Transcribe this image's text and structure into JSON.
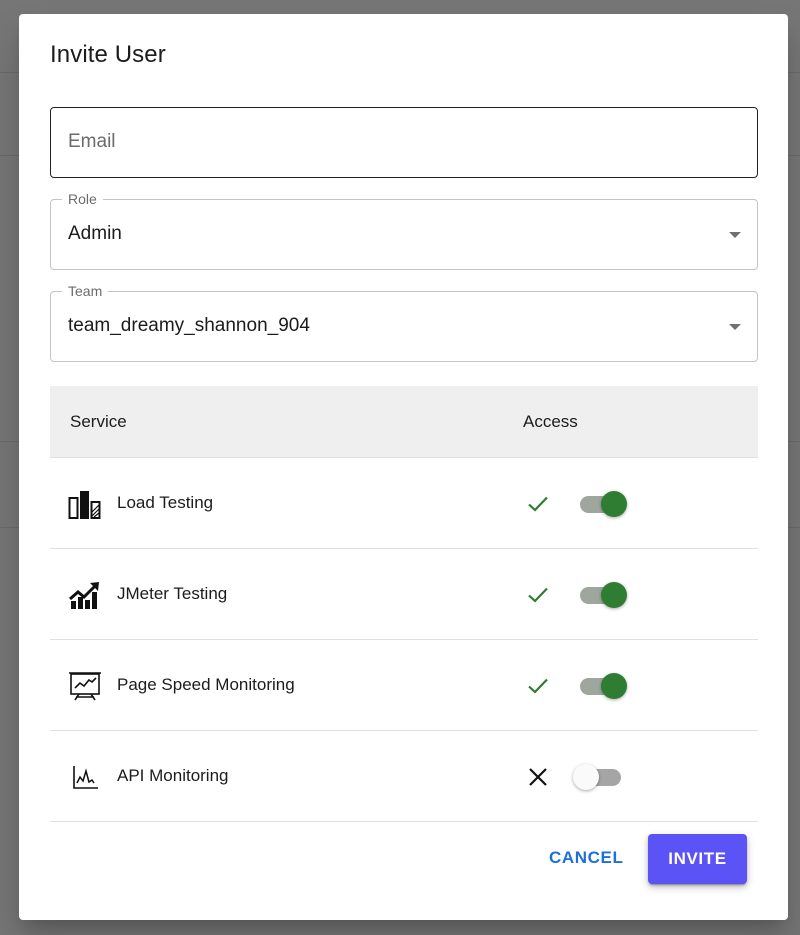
{
  "dialog": {
    "title": "Invite User",
    "email": {
      "placeholder": "Email",
      "value": ""
    },
    "role": {
      "label": "Role",
      "value": "Admin"
    },
    "team": {
      "label": "Team",
      "value": "team_dreamy_shannon_904"
    },
    "table": {
      "headers": {
        "service": "Service",
        "access": "Access"
      },
      "rows": [
        {
          "icon": "bar-chart-icon",
          "label": "Load Testing",
          "access": true,
          "status_icon": "check-icon"
        },
        {
          "icon": "trending-up-icon",
          "label": "JMeter Testing",
          "access": true,
          "status_icon": "check-icon"
        },
        {
          "icon": "presentation-chart-icon",
          "label": "Page Speed Monitoring",
          "access": true,
          "status_icon": "check-icon"
        },
        {
          "icon": "pulse-chart-icon",
          "label": "API Monitoring",
          "access": false,
          "status_icon": "close-icon"
        }
      ]
    },
    "actions": {
      "cancel": "CANCEL",
      "invite": "INVITE"
    }
  },
  "colors": {
    "accent": "#5b53f5",
    "link": "#1e6fd9",
    "success": "#2e7d32",
    "header_bg": "#efefef"
  }
}
